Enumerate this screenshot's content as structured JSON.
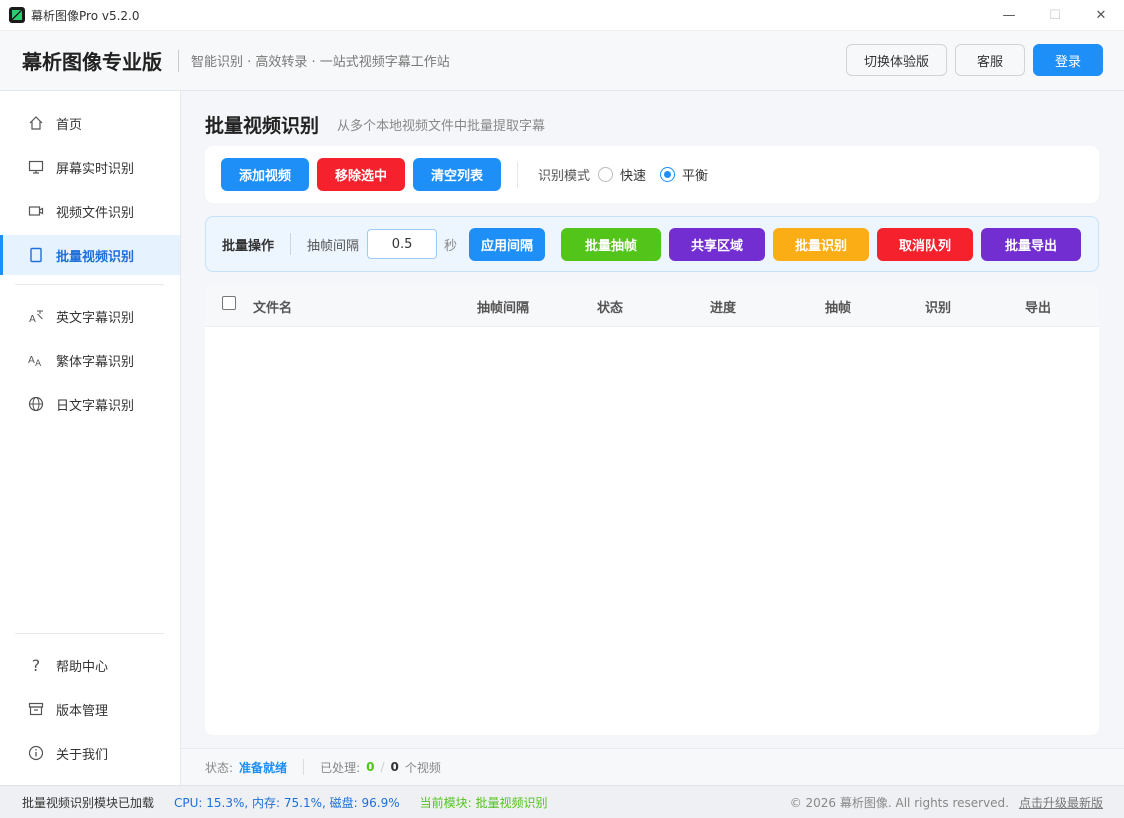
{
  "window": {
    "title": "幕析图像Pro v5.2.0"
  },
  "header": {
    "brand": "幕析图像专业版",
    "tagline": "智能识别 · 高效转录 · 一站式视频字幕工作站",
    "switch_label": "切换体验版",
    "service_label": "客服",
    "login_label": "登录"
  },
  "sidebar": {
    "items": [
      {
        "label": "首页",
        "icon": "home-icon"
      },
      {
        "label": "屏幕实时识别",
        "icon": "monitor-icon"
      },
      {
        "label": "视频文件识别",
        "icon": "video-camera-icon"
      },
      {
        "label": "批量视频识别",
        "icon": "document-icon",
        "active": true
      },
      {
        "label": "英文字幕识别",
        "icon": "translate-icon"
      },
      {
        "label": "繁体字幕识别",
        "icon": "font-size-icon"
      },
      {
        "label": "日文字幕识别",
        "icon": "globe-icon"
      }
    ],
    "bottom": [
      {
        "label": "帮助中心",
        "icon": "question-icon"
      },
      {
        "label": "版本管理",
        "icon": "archive-icon"
      },
      {
        "label": "关于我们",
        "icon": "info-icon"
      }
    ]
  },
  "main": {
    "title": "批量视频识别",
    "subtitle": "从多个本地视频文件中批量提取字幕",
    "toolbar": {
      "add_label": "添加视频",
      "remove_label": "移除选中",
      "clear_label": "清空列表",
      "mode_label": "识别模式",
      "mode_fast": "快速",
      "mode_balanced": "平衡",
      "selected_mode": "平衡"
    },
    "batch": {
      "label": "批量操作",
      "interval_label": "抽帧间隔",
      "interval_value": "0.5",
      "interval_unit": "秒",
      "apply_label": "应用间隔",
      "extract_label": "批量抽帧",
      "share_label": "共享区域",
      "recognize_label": "批量识别",
      "cancel_label": "取消队列",
      "export_label": "批量导出"
    },
    "table": {
      "columns": [
        "文件名",
        "抽帧间隔",
        "状态",
        "进度",
        "抽帧",
        "识别",
        "导出"
      ],
      "rows": []
    }
  },
  "status": {
    "label": "状态:",
    "value": "准备就绪",
    "processed_label": "已处理:",
    "processed": "0",
    "slash": "/",
    "total": "0",
    "unit": "个视频"
  },
  "footer": {
    "left": "批量视频识别模块已加载",
    "metrics": "CPU: 15.3%, 内存: 75.1%, 磁盘: 96.9%",
    "module": "当前模块: 批量视频识别",
    "copyright": "© 2026 幕析图像. All rights reserved.",
    "upgrade": "点击升级最新版"
  },
  "colors": {
    "primary": "#1e8ff7",
    "danger": "#f5222d",
    "success": "#52c41a",
    "purple": "#722ed1",
    "warning": "#faad14"
  }
}
